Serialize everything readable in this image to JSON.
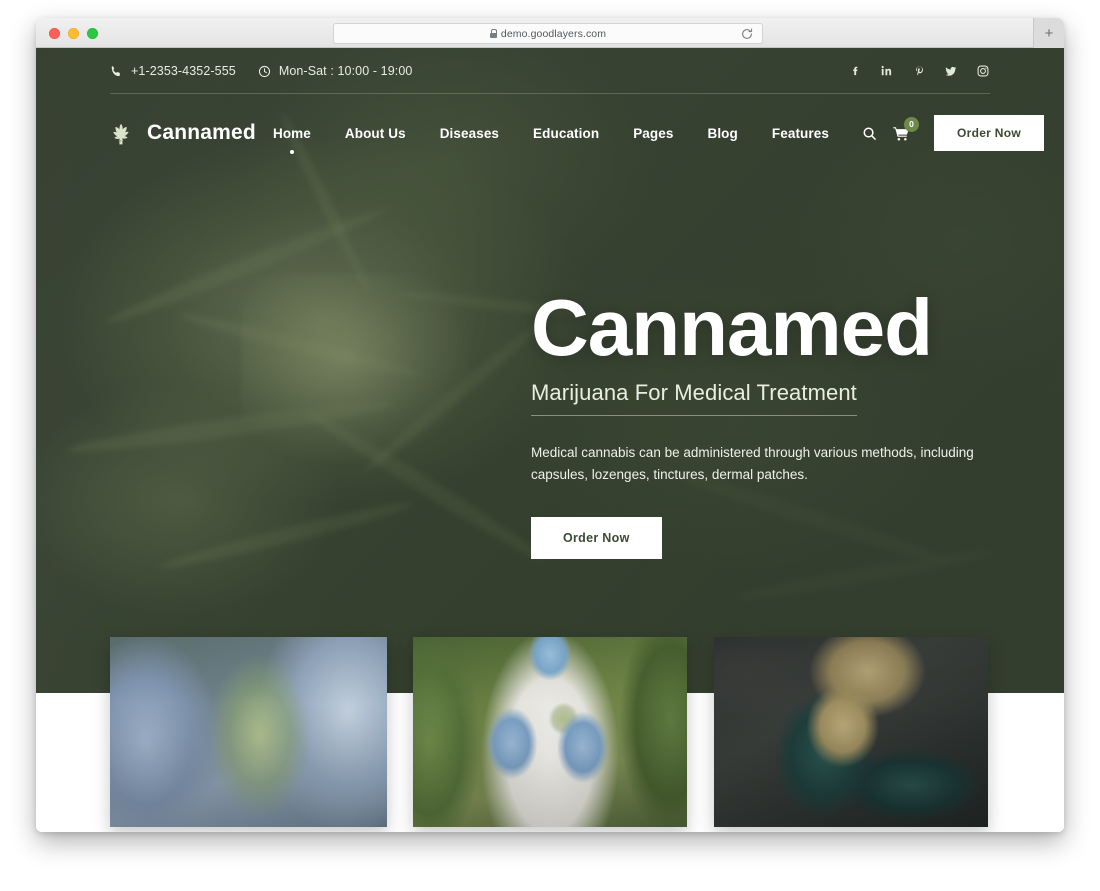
{
  "browser": {
    "url": "demo.goodlayers.com",
    "lock_icon": "lock-icon",
    "reload_icon": "reload-icon",
    "new_tab_label": "+",
    "traffic_lights": [
      "close",
      "minimize",
      "zoom"
    ]
  },
  "topbar": {
    "phone_icon": "phone-icon",
    "phone": "+1-2353-4352-555",
    "clock_icon": "clock-icon",
    "hours": "Mon-Sat : 10:00 - 19:00",
    "socials": [
      {
        "name": "facebook-icon",
        "glyph": "f"
      },
      {
        "name": "linkedin-icon",
        "glyph": "in"
      },
      {
        "name": "pinterest-icon",
        "glyph": "P"
      },
      {
        "name": "twitter-icon",
        "glyph": "t"
      },
      {
        "name": "instagram-icon",
        "glyph": "ig"
      }
    ]
  },
  "header": {
    "logo_icon": "cannabis-leaf-icon",
    "logo_text": "Cannamed",
    "nav": [
      {
        "label": "Home",
        "active": true
      },
      {
        "label": "About Us",
        "active": false
      },
      {
        "label": "Diseases",
        "active": false
      },
      {
        "label": "Education",
        "active": false
      },
      {
        "label": "Pages",
        "active": false
      },
      {
        "label": "Blog",
        "active": false
      },
      {
        "label": "Features",
        "active": false
      }
    ],
    "search_icon": "search-icon",
    "cart_icon": "shopping-cart-icon",
    "cart_count": "0",
    "order_button": "Order Now"
  },
  "hero": {
    "title": "Cannamed",
    "subtitle": "Marijuana For Medical Treatment",
    "paragraph": "Medical cannabis can be administered through various methods, including capsules, lozenges, tinctures, dermal patches.",
    "cta": "Order Now"
  },
  "cards": [
    {
      "name": "card-gloved-hands-cannabis-bud",
      "alt": "Gloved hands holding a cannabis bud with masked researcher"
    },
    {
      "name": "card-scientist-lab-coat",
      "alt": "Scientist in white lab coat and mask inspecting cannabis"
    },
    {
      "name": "card-glass-pipe-bud",
      "alt": "Teal glass pipe filled with cannabis bud"
    }
  ],
  "colors": {
    "hero_overlay": "#3b4637",
    "accent_white": "#ffffff",
    "badge_green": "#6d8a4a",
    "button_text": "#3c4a33"
  }
}
